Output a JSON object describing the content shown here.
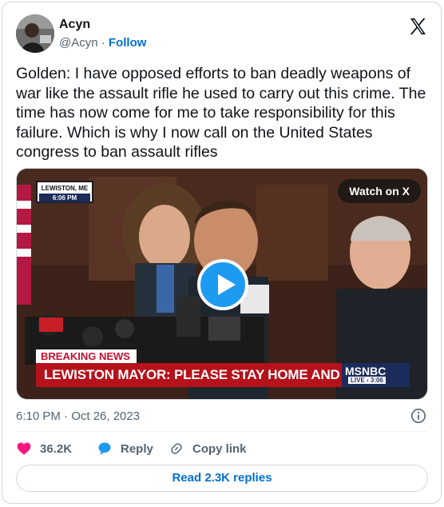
{
  "author": {
    "name": "Acyn",
    "handle": "@Acyn",
    "separator": "·",
    "follow_label": "Follow"
  },
  "tweet": {
    "text": "Golden: I have opposed efforts to ban deadly weapons of war like the assault rifle he used to carry out this crime. The time has now come for me to take responsibility for this failure. Which is why I now call on the United States congress to ban assault rifles"
  },
  "media": {
    "location_line1": "LEWISTON, ME",
    "location_time": "6:06 PM",
    "watch_label": "Watch on X",
    "breaking_label": "BREAKING NEWS",
    "chyron": "LEWISTON MAYOR: PLEASE STAY HOME AND BE SAFE",
    "network": "MSNBC",
    "live_label": "LIVE › 3:06"
  },
  "meta": {
    "timestamp": "6:10 PM · Oct 26, 2023"
  },
  "actions": {
    "likes": "36.2K",
    "reply_label": "Reply",
    "copy_label": "Copy link"
  },
  "read_replies": "Read 2.3K replies",
  "colors": {
    "accent": "#1d9bf0",
    "link": "#006fd6",
    "like": "#f91880",
    "chyron_red": "#b5121b",
    "network_navy": "#1b2c5a"
  },
  "icons": [
    "x-logo-icon",
    "play-icon",
    "info-icon",
    "heart-icon",
    "reply-bubble-icon",
    "link-icon"
  ]
}
